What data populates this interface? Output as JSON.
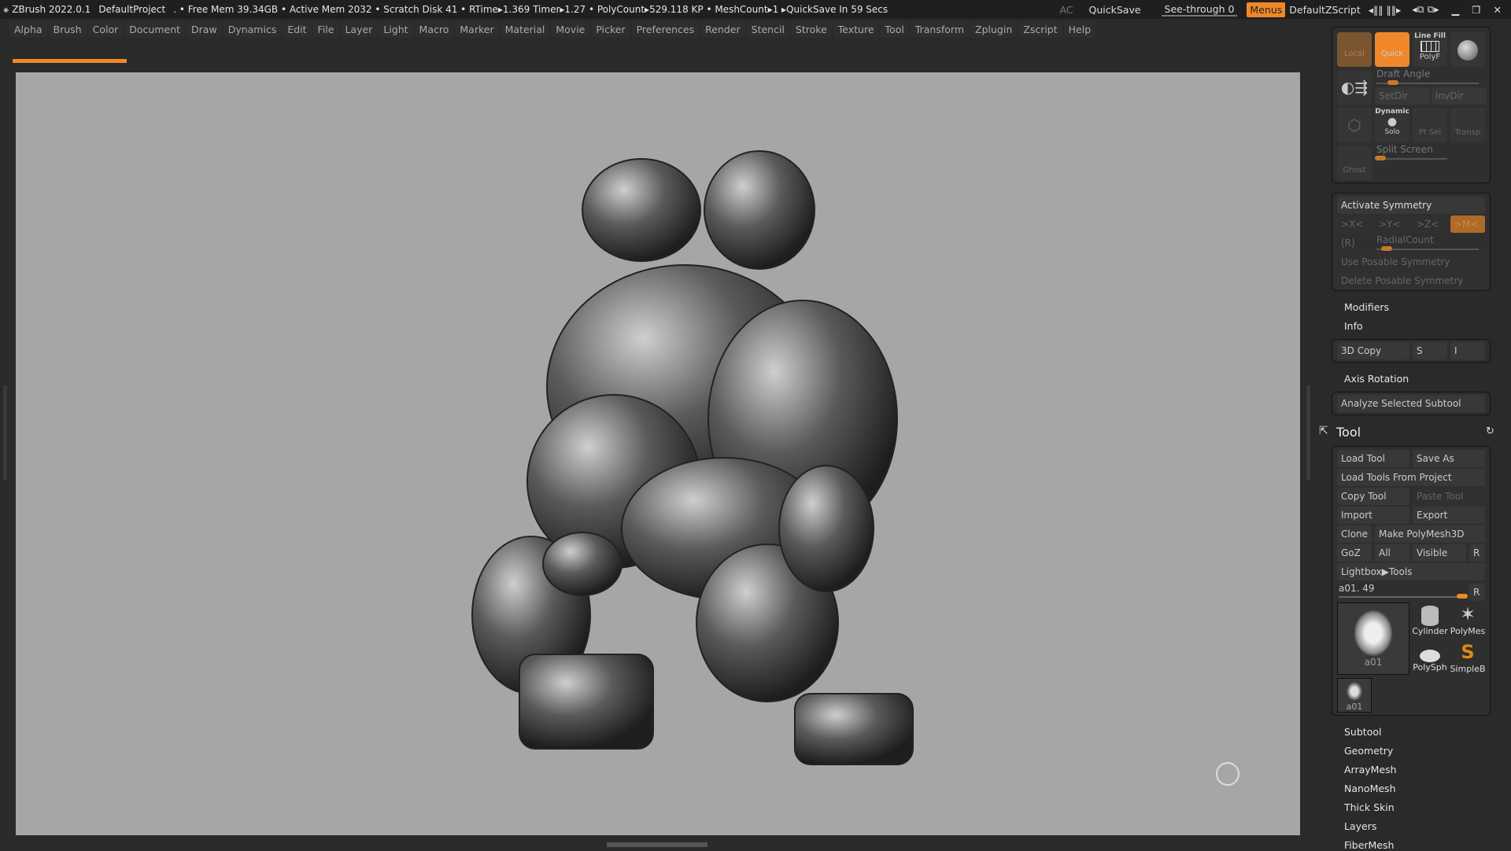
{
  "title_bar": {
    "app": "ZBrush 2022.0.1",
    "project": "DefaultProject",
    "status": ". • Free Mem 39.34GB • Active Mem 2032 • Scratch Disk 41 • RTime▸1.369 Timer▸1.27 • PolyCount▸529.118 KP • MeshCount▸1 ▸QuickSave In 59 Secs",
    "ac": "AC",
    "quicksave": "QuickSave",
    "see_through": "See-through  0",
    "menus": "Menus",
    "script": "DefaultZScript"
  },
  "menu": [
    "Alpha",
    "Brush",
    "Color",
    "Document",
    "Draw",
    "Dynamics",
    "Edit",
    "File",
    "Layer",
    "Light",
    "Macro",
    "Marker",
    "Material",
    "Movie",
    "Picker",
    "Preferences",
    "Render",
    "Stencil",
    "Stroke",
    "Texture",
    "Tool",
    "Transform",
    "Zplugin",
    "Zscript",
    "Help"
  ],
  "progress": 0.11,
  "top_panel": {
    "local": "Local",
    "quick": "Quick",
    "linefill": "Line Fill",
    "polyf": "PolyF",
    "draft_angle": "Draft Angle",
    "setdir": "SetDir",
    "invdir": "InvDir",
    "dynamic": "Dynamic",
    "solo": "Solo",
    "ptsel": "Pt Sel",
    "transp": "Transp",
    "ghost": "Ghost",
    "split_screen": "Split Screen"
  },
  "symmetry": {
    "title": "Activate Symmetry",
    "x": ">X<",
    "y": ">Y<",
    "z": ">Z<",
    "m": ">M<",
    "r": "(R)",
    "radial": "RadialCount",
    "use_posable": "Use Posable Symmetry",
    "delete_posable": "Delete Posable Symmetry"
  },
  "modifiers": "Modifiers",
  "info": "Info",
  "copy3d": {
    "label": "3D Copy",
    "s": "S",
    "i": "I"
  },
  "axis_rotation": "Axis Rotation",
  "analyze": "Analyze Selected Subtool",
  "tool": {
    "title": "Tool",
    "load": "Load Tool",
    "save_as": "Save As",
    "load_project": "Load Tools From Project",
    "copy": "Copy Tool",
    "paste": "Paste Tool",
    "import": "Import",
    "export": "Export",
    "clone": "Clone",
    "make_polymesh": "Make PolyMesh3D",
    "goz": "GoZ",
    "all": "All",
    "visible": "Visible",
    "r": "R",
    "lightbox": "Lightbox▶Tools",
    "current": "a01. 49",
    "thumbs": [
      "a01",
      "Cylinder",
      "PolyMes",
      "PolySph",
      "SimpleB",
      "a01"
    ]
  },
  "sections": [
    "Subtool",
    "Geometry",
    "ArrayMesh",
    "NanoMesh",
    "Thick Skin",
    "Layers",
    "FiberMesh"
  ]
}
